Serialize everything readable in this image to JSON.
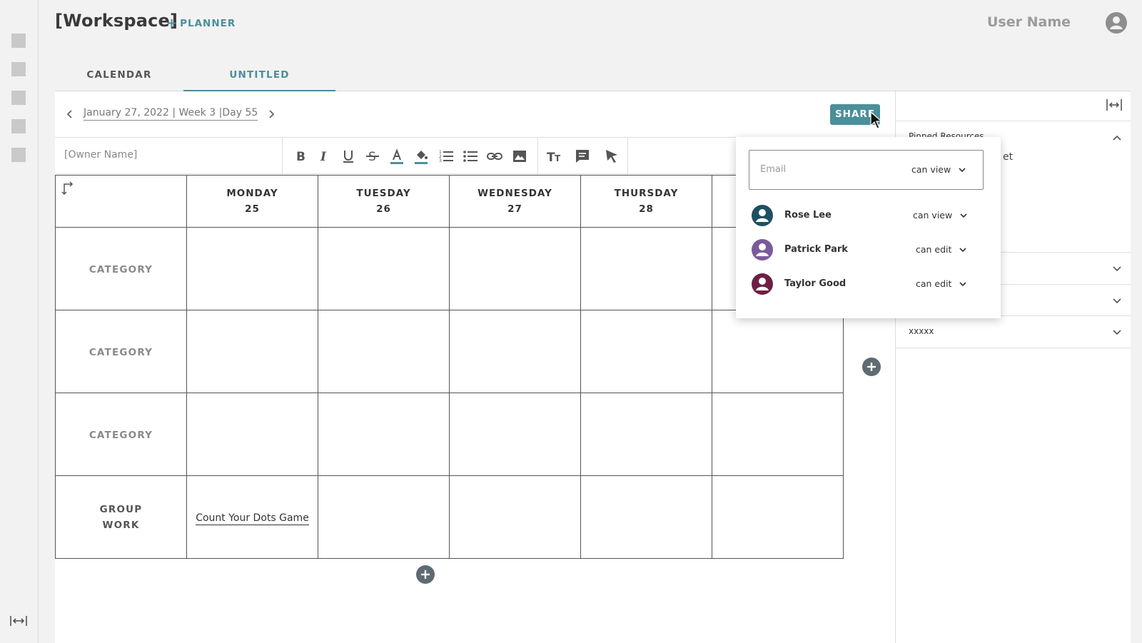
{
  "header": {
    "workspace_title": "[Workspace]",
    "add_planner_label": "PLANNER",
    "user_name": "User Name"
  },
  "tabs": [
    {
      "label": "CALENDAR"
    },
    {
      "label": "UNTITLED"
    }
  ],
  "date_nav": {
    "label": "January 27, 2022 | Week 3 |Day 55"
  },
  "share_button": "SHARE",
  "toolbar": {
    "owner_name": "[Owner Name]"
  },
  "planner": {
    "days": [
      {
        "name": "MONDAY",
        "num": "25"
      },
      {
        "name": "TUESDAY",
        "num": "26"
      },
      {
        "name": "WEDNESDAY",
        "num": "27"
      },
      {
        "name": "THURSDAY",
        "num": "28"
      }
    ],
    "rows": [
      {
        "label": "CATEGORY"
      },
      {
        "label": "CATEGORY"
      },
      {
        "label": "CATEGORY"
      },
      {
        "label_line1": "GROUP",
        "label_line2": "WORK",
        "monday_entry": "Count Your Dots Game"
      }
    ]
  },
  "share_popup": {
    "email_placeholder": "Email",
    "email_permission": "can view",
    "people": [
      {
        "name": "Rose Lee",
        "permission": "can view",
        "color": "#1f4f63"
      },
      {
        "name": "Patrick Park",
        "permission": "can edit",
        "color": "#7a5a9c"
      },
      {
        "name": "Taylor Good",
        "permission": "can edit",
        "color": "#6e1f45"
      }
    ]
  },
  "right_panel": {
    "pinned_label": "Pinned Resources",
    "pinned_peek": "et",
    "last_section_label": "xxxxx"
  },
  "colors": {
    "accent": "#4a8f9b"
  }
}
